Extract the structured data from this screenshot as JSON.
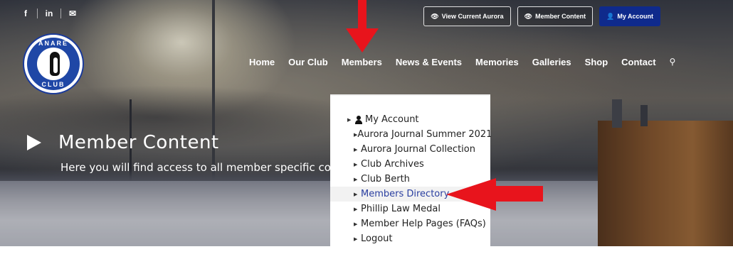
{
  "social": {
    "facebook": "f",
    "linkedin": "in",
    "email_icon": "envelope-icon"
  },
  "top_buttons": [
    {
      "label": "View Current Aurora",
      "icon": "eye-icon"
    },
    {
      "label": "Member Content",
      "icon": "eye-icon"
    },
    {
      "label": "My Account",
      "icon": "user-icon"
    }
  ],
  "logo": {
    "top_text": "ANARE",
    "bottom_text": "CLUB"
  },
  "nav": {
    "items": [
      "Home",
      "Our Club",
      "Members",
      "News & Events",
      "Memories",
      "Galleries",
      "Shop",
      "Contact"
    ],
    "search_icon": "search-icon"
  },
  "hero": {
    "title": "Member Content",
    "subtitle": "Here you will find access to all member specific content"
  },
  "dropdown": {
    "items": [
      "My Account",
      "Aurora Journal Summer 2021",
      "Aurora Journal Collection",
      "Club Archives",
      "Club Berth",
      "Members Directory",
      "Phillip Law Medal",
      "Member Help Pages (FAQs)",
      "Logout"
    ],
    "active_item": "Members Directory"
  },
  "colors": {
    "accent": "#0f2a8c",
    "annotation_arrow": "#e8141c",
    "active_link": "#2a3fa0"
  }
}
